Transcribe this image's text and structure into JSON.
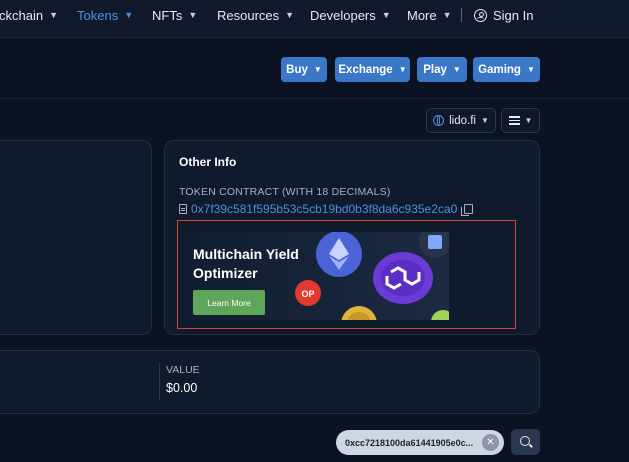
{
  "nav": {
    "items": [
      {
        "label": "ckchain",
        "active": false
      },
      {
        "label": "Tokens",
        "active": true
      },
      {
        "label": "NFTs",
        "active": false
      },
      {
        "label": "Resources",
        "active": false
      },
      {
        "label": "Developers",
        "active": false
      },
      {
        "label": "More",
        "active": false
      }
    ],
    "sign_in": "Sign In"
  },
  "toolbar": {
    "buy": "Buy",
    "exchange": "Exchange",
    "play": "Play",
    "gaming": "Gaming"
  },
  "site_selector": {
    "label": "lido.fi"
  },
  "other_info": {
    "title": "Other Info",
    "contract_label": "TOKEN CONTRACT (WITH 18 DECIMALS)",
    "contract_address": "0x7f39c581f595b53c5cb19bd0b3f8da6c935e2ca0"
  },
  "ad": {
    "title": "Multichain Yield Optimizer",
    "cta": "Learn More",
    "coin_label": "OP"
  },
  "holdings": {
    "value_label": "VALUE",
    "value_amount": "$0.00"
  },
  "filter": {
    "address": "0xcc7218100da61441905e0c...",
    "clear": "✕"
  },
  "colors": {
    "accent": "#3a78c7",
    "link": "#4f8fe0",
    "highlight_border": "#d9412f",
    "cta_green": "#5fa55a"
  }
}
